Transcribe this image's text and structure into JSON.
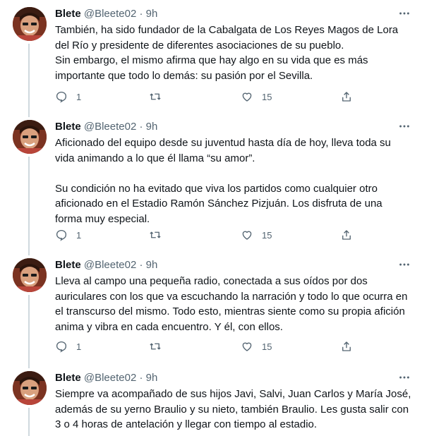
{
  "tweets": [
    {
      "name": "Blete",
      "handle": "@Bleete02",
      "time": "9h",
      "separator": "·",
      "paragraphs": [
        "También, ha sido fundador de la Cabalgata de Los Reyes Magos de Lora del Río y presidente de diferentes asociaciones de su pueblo.",
        "Sin embargo, el mismo afirma que hay algo en su vida que es más importante que todo lo demás: su pasión por el Sevilla."
      ],
      "replies": "1",
      "retweets": "",
      "likes": "15"
    },
    {
      "name": "Blete",
      "handle": "@Bleete02",
      "time": "9h",
      "separator": "·",
      "paragraphs": [
        "Aficionado del equipo desde su juventud hasta día de hoy, lleva toda su vida animando a lo que él llama “su amor”.",
        "Su condición no ha evitado que viva los partidos como cualquier otro aficionado en el Estadio Ramón Sánchez Pizjuán. Los disfruta de una forma muy especial."
      ],
      "replies": "1",
      "retweets": "",
      "likes": "15"
    },
    {
      "name": "Blete",
      "handle": "@Bleete02",
      "time": "9h",
      "separator": "·",
      "paragraphs": [
        "Lleva al campo una pequeña radio, conectada a sus oídos por dos auriculares con los que va escuchando la narración y todo lo que ocurra en el transcurso del mismo. Todo esto, mientras siente como su propia afición anima y vibra en cada encuentro. Y él, con ellos."
      ],
      "replies": "1",
      "retweets": "",
      "likes": "15"
    },
    {
      "name": "Blete",
      "handle": "@Bleete02",
      "time": "9h",
      "separator": "·",
      "paragraphs": [
        "Siempre va acompañado de sus hijos Javi, Salvi, Juan Carlos y María José, además de su yerno Braulio y su nieto, también Braulio. Les gusta salir con 3 o 4 horas de antelación y llegar con tiempo al estadio."
      ]
    }
  ],
  "icons": {
    "reply": "reply-icon",
    "retweet": "retweet-icon",
    "like": "like-icon",
    "share": "share-icon",
    "more": "more-icon"
  },
  "colors": {
    "text": "#0f1419",
    "secondary": "#536471",
    "thread_line": "#cfd9de"
  }
}
